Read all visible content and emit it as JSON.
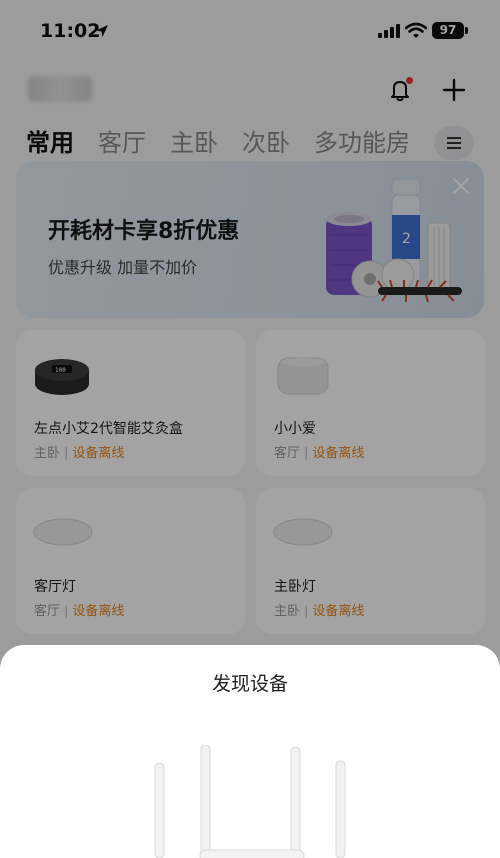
{
  "status_bar": {
    "time": "11:02",
    "battery": "97"
  },
  "header": {
    "home_name": ""
  },
  "tabs": [
    {
      "label": "常用",
      "active": true
    },
    {
      "label": "客厅",
      "active": false
    },
    {
      "label": "主卧",
      "active": false
    },
    {
      "label": "次卧",
      "active": false
    },
    {
      "label": "多功能房",
      "active": false
    }
  ],
  "banner": {
    "title": "开耗材卡享8折优惠",
    "subtitle": "优惠升级 加量不加价"
  },
  "devices": [
    {
      "name": "左点小艾2代智能艾灸盒",
      "room": "主卧",
      "status": "设备离线",
      "icon": "moxibustion-box-icon"
    },
    {
      "name": "小小爱",
      "room": "客厅",
      "status": "设备离线",
      "icon": "smart-speaker-icon"
    },
    {
      "name": "客厅灯",
      "room": "客厅",
      "status": "设备离线",
      "icon": "ceiling-light-icon"
    },
    {
      "name": "主卧灯",
      "room": "主卧",
      "status": "设备离线",
      "icon": "ceiling-light-icon"
    }
  ],
  "sheet": {
    "title": "发现设备",
    "icon": "router-icon"
  },
  "colors": {
    "offline": "#e8861a",
    "notification_dot": "#e53935"
  }
}
